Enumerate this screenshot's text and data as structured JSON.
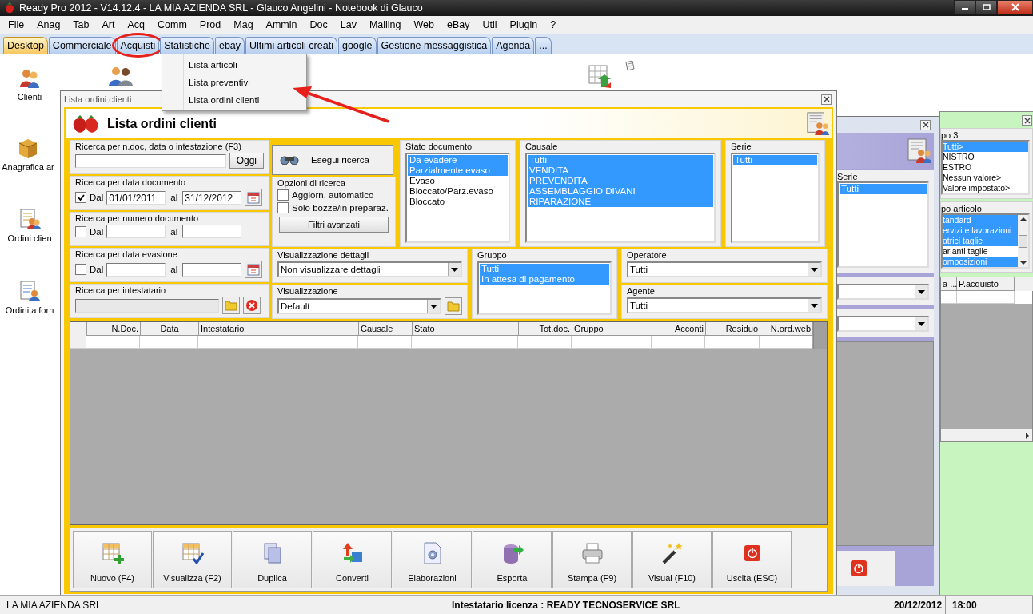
{
  "window": {
    "title": "Ready Pro 2012 - V14.12.4 - LA MIA AZIENDA SRL - Glauco Angelini - Notebook di Glauco"
  },
  "menu": [
    "File",
    "Anag",
    "Tab",
    "Art",
    "Acq",
    "Comm",
    "Prod",
    "Mag",
    "Ammin",
    "Doc",
    "Lav",
    "Mailing",
    "Web",
    "eBay",
    "Util",
    "Plugin",
    "?"
  ],
  "tabs": [
    {
      "label": "Desktop",
      "selected": true
    },
    {
      "label": "Commerciale",
      "selected": false
    },
    {
      "label": "Acquisti",
      "selected": false
    },
    {
      "label": "Statistiche",
      "selected": false
    },
    {
      "label": "ebay",
      "selected": false
    },
    {
      "label": "Ultimi articoli creati",
      "selected": false
    },
    {
      "label": "google",
      "selected": false
    },
    {
      "label": "Gestione messaggistica",
      "selected": false
    },
    {
      "label": "Agenda",
      "selected": false
    },
    {
      "label": "...",
      "selected": false
    }
  ],
  "tab_menu": [
    "Lista articoli",
    "Lista preventivi",
    "Lista ordini clienti"
  ],
  "desktop_icons": [
    {
      "kind": "clients",
      "label": "Clienti"
    },
    {
      "kind": "boxes",
      "label": "Anagrafica ar"
    },
    {
      "kind": "orders",
      "label": "Ordini clien"
    },
    {
      "kind": "supplier_orders",
      "label": "Ordini a forn"
    }
  ],
  "back_window_1": {
    "serie": {
      "legend": "Serie",
      "items": [
        {
          "label": "Tutti",
          "selected": true
        }
      ]
    }
  },
  "back_window_2": {
    "lists": [
      {
        "legend": "po 3",
        "items": [
          {
            "label": "Tutti>",
            "selected": true
          },
          {
            "label": "NISTRO",
            "selected": false
          },
          {
            "label": "ESTRO",
            "selected": false
          },
          {
            "label": "Nessun valore>",
            "selected": false
          },
          {
            "label": "Valore impostato>",
            "selected": false
          }
        ]
      },
      {
        "legend": "po articolo",
        "items": [
          {
            "label": "tandard",
            "selected": true
          },
          {
            "label": "ervizi e lavorazioni",
            "selected": true
          },
          {
            "label": "atrici taglie",
            "selected": true
          },
          {
            "label": "arianti taglie",
            "selected": false
          },
          {
            "label": "omposizioni",
            "selected": true
          }
        ]
      }
    ],
    "columns": [
      "a ...",
      "P.acquisto"
    ]
  },
  "order_window": {
    "title": "Lista ordini clienti",
    "heading": "Lista ordini clienti",
    "quick_search": {
      "legend": "Ricerca per n.doc, data o intestazione (F3)",
      "button": "Oggi"
    },
    "ranges": [
      {
        "legend": "Ricerca per data documento",
        "checked": true,
        "from_label": "Dal",
        "from": "01/01/2011",
        "to_label": "al",
        "to": "31/12/2012",
        "calendar": true
      },
      {
        "legend": "Ricerca per numero documento",
        "checked": false,
        "from_label": "Dal",
        "to_label": "al",
        "calendar": false
      },
      {
        "legend": "Ricerca per data evasione",
        "checked": false,
        "from_label": "Dal",
        "to_label": "al",
        "calendar": true
      }
    ],
    "customer": {
      "legend": "Ricerca per intestatario"
    },
    "search_button": "Esegui ricerca",
    "options": {
      "legend": "Opzioni di ricerca",
      "items": [
        {
          "label": "Aggiorn. automatico",
          "checked": false
        },
        {
          "label": "Solo bozze/in preparaz.",
          "checked": false
        }
      ],
      "button": "Filtri avanzati"
    },
    "lists": [
      {
        "legend": "Stato documento",
        "items": [
          {
            "label": "Da evadere",
            "selected": true
          },
          {
            "label": "Parzialmente evaso",
            "selected": true
          },
          {
            "label": "Evaso",
            "selected": false
          },
          {
            "label": "Bloccato/Parz.evaso",
            "selected": false
          },
          {
            "label": "Bloccato",
            "selected": false
          }
        ]
      },
      {
        "legend": "Causale",
        "items": [
          {
            "label": "Tutti",
            "selected": true
          },
          {
            "label": "VENDITA",
            "selected": true
          },
          {
            "label": "PREVENDITA",
            "selected": true
          },
          {
            "label": "ASSEMBLAGGIO DIVANI",
            "selected": true
          },
          {
            "label": "RIPARAZIONE",
            "selected": true
          }
        ]
      },
      {
        "legend": "Serie",
        "items": [
          {
            "label": "Tutti",
            "selected": true
          }
        ]
      }
    ],
    "details": {
      "legend": "Visualizzazione dettagli",
      "value": "Non visualizzare dettagli"
    },
    "view": {
      "legend": "Visualizzazione",
      "value": "Default"
    },
    "group": {
      "legend": "Gruppo",
      "items": [
        {
          "label": "Tutti",
          "selected": true
        },
        {
          "label": "In attesa di pagamento",
          "selected": true
        }
      ]
    },
    "operator": {
      "legend": "Operatore",
      "value": "Tutti"
    },
    "agent": {
      "legend": "Agente",
      "value": "Tutti"
    },
    "table": {
      "columns": [
        "N.Doc.",
        "Data",
        "Intestatario",
        "Causale",
        "Stato",
        "Tot.doc.",
        "Gruppo",
        "Acconti",
        "Residuo",
        "N.ord.web"
      ]
    },
    "actions": [
      {
        "kind": "new",
        "label": "Nuovo (F4)"
      },
      {
        "kind": "view",
        "label": "Visualizza (F2)"
      },
      {
        "kind": "duplicate",
        "label": "Duplica"
      },
      {
        "kind": "convert",
        "label": "Converti"
      },
      {
        "kind": "process",
        "label": "Elaborazioni"
      },
      {
        "kind": "export",
        "label": "Esporta"
      },
      {
        "kind": "print",
        "label": "Stampa (F9)"
      },
      {
        "kind": "wand",
        "label": "Visual (F10)"
      },
      {
        "kind": "exit",
        "label": "Uscita (ESC)"
      }
    ]
  },
  "status_bar": {
    "company": "LA MIA AZIENDA SRL",
    "license": "Intestatario licenza : READY TECNOSERVICE SRL",
    "date": "20/12/2012",
    "time": "18:00"
  }
}
